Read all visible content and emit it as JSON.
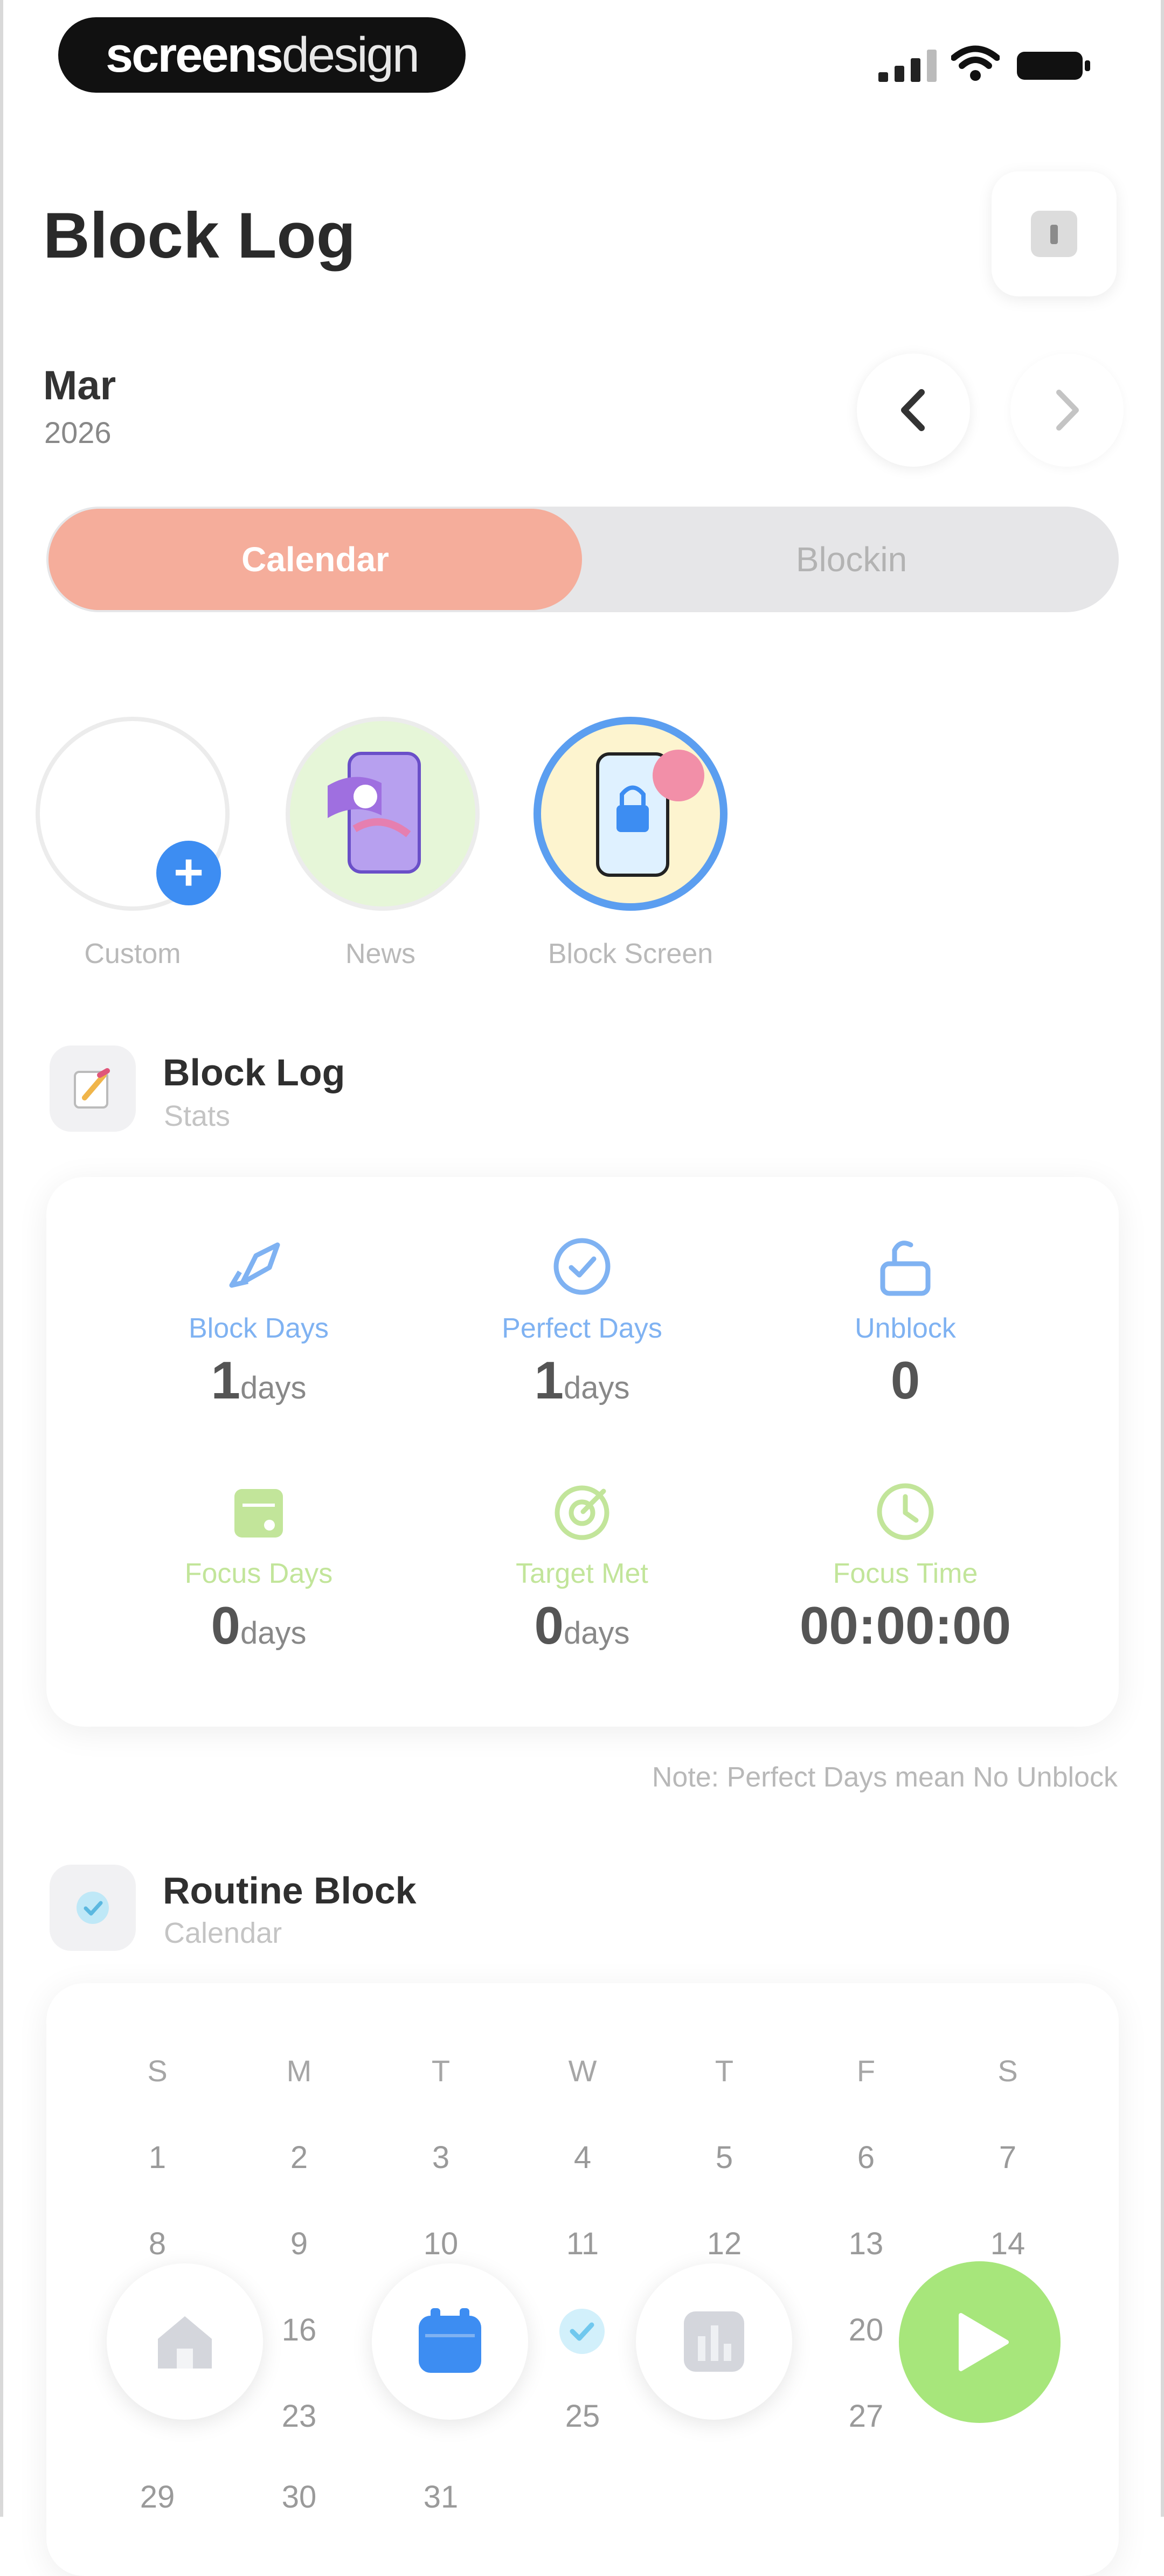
{
  "status_bar": {
    "brand_bold": "screens",
    "brand_light": "design"
  },
  "header": {
    "title": "Block Log",
    "info_icon": "info-icon"
  },
  "date_nav": {
    "month": "Mar",
    "year": "2026",
    "prev_icon": "chevron-left-icon",
    "next_icon": "chevron-right-icon"
  },
  "segmented": {
    "active": "Calendar",
    "inactive": "Blockin"
  },
  "stories": [
    {
      "label": "Custom"
    },
    {
      "label": "News"
    },
    {
      "label": "Block Screen"
    }
  ],
  "block_log": {
    "title": "Block Log",
    "subtitle": "Stats",
    "stats": [
      {
        "label": "Block Days",
        "value": "1",
        "unit": "days",
        "icon": "rocket-icon",
        "color": "#7fb2f2"
      },
      {
        "label": "Perfect Days",
        "value": "1",
        "unit": "days",
        "icon": "check-circle-icon",
        "color": "#7fb2f2"
      },
      {
        "label": "Unblock",
        "value": "0",
        "unit": "",
        "icon": "unlock-icon",
        "color": "#7fb2f2"
      },
      {
        "label": "Focus Days",
        "value": "0",
        "unit": "days",
        "icon": "calendar-icon",
        "color": "#c2e59a"
      },
      {
        "label": "Target Met",
        "value": "0",
        "unit": "days",
        "icon": "target-icon",
        "color": "#c2e59a"
      },
      {
        "label": "Focus Time",
        "value": "00:00:00",
        "unit": "",
        "icon": "clock-icon",
        "color": "#c2e59a"
      }
    ],
    "note": "Note: Perfect Days mean No Unblock"
  },
  "routine_block": {
    "title": "Routine Block",
    "subtitle": "Calendar",
    "weekdays": [
      "S",
      "M",
      "T",
      "W",
      "T",
      "F",
      "S"
    ],
    "rows": [
      [
        "1",
        "2",
        "3",
        "4",
        "5",
        "6",
        "7"
      ],
      [
        "8",
        "9",
        "10",
        "11",
        "12",
        "13",
        "14"
      ],
      [
        "",
        "16",
        "",
        "",
        "",
        "20",
        ""
      ],
      [
        "",
        "23",
        "",
        "25",
        "",
        "27",
        ""
      ],
      [
        "29",
        "30",
        "31",
        "",
        "",
        "",
        ""
      ]
    ]
  },
  "tab_bar": {
    "home_icon": "home-icon",
    "calendar_icon": "calendar-icon",
    "stats_icon": "stats-icon",
    "play_icon": "play-icon"
  },
  "colors": {
    "accent_salmon": "#f5ad9b",
    "accent_blue": "#3d8df2",
    "accent_green": "#a7e67b"
  }
}
